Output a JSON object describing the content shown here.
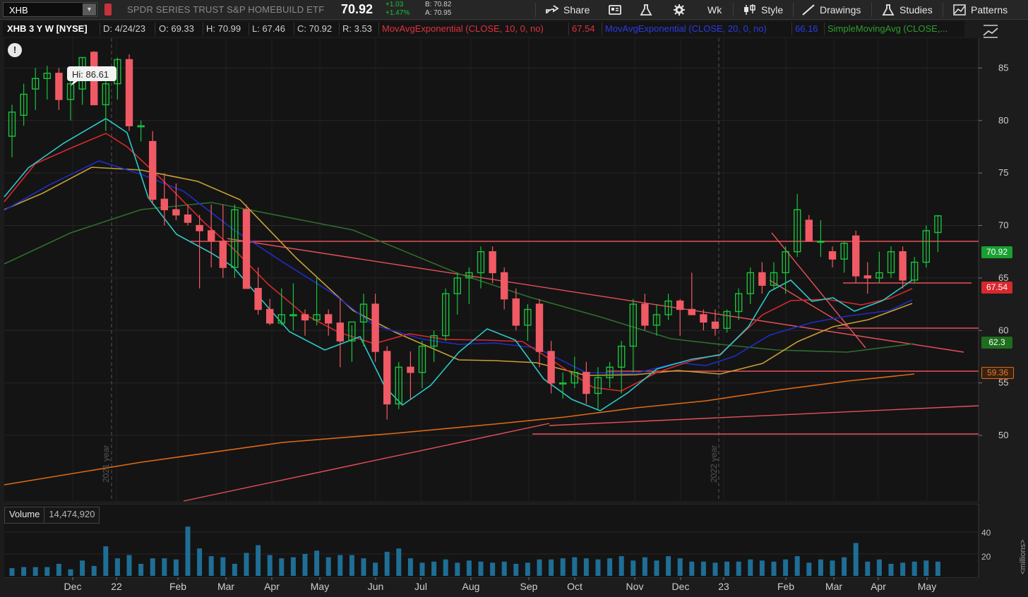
{
  "toolbar": {
    "symbol": "XHB",
    "security_name": "SPDR SERIES TRUST S&P HOMEBUILD ETF",
    "last": "70.92",
    "change": "+1.03",
    "change_pct": "+1.47%",
    "bid": "B: 70.82",
    "ask": "A: 70.95",
    "share": "Share",
    "aggregation": "Wk",
    "style": "Style",
    "drawings": "Drawings",
    "studies": "Studies",
    "patterns": "Patterns"
  },
  "legend": {
    "title": "XHB 3 Y W [NYSE]",
    "date": "D: 4/24/23",
    "open": "O: 69.33",
    "high": "H: 70.99",
    "low": "L: 67.46",
    "close": "C: 70.92",
    "range": "R: 3.53",
    "study1_name": "MovAvgExponential (CLOSE, 10, 0, no)",
    "study1_value": "67.54",
    "study2_name": "MovAvgExponential (CLOSE, 20, 0, no)",
    "study2_value": "66.16",
    "study3_name": "SimpleMovingAvg (CLOSE,..."
  },
  "hi_label": "Hi: 86.61",
  "year_markers": [
    "2021 year",
    "2022 year"
  ],
  "price_tags": {
    "last": "70.92",
    "ema10": "67.54",
    "sma_a": "62.3",
    "sma_b": "59.36"
  },
  "volume": {
    "title": "Volume",
    "value": "14,474,920",
    "unit": "<millions>",
    "ticks": [
      "40",
      "20"
    ]
  },
  "time_axis": [
    "Dec",
    "22",
    "Feb",
    "Mar",
    "Apr",
    "May",
    "Jun",
    "Jul",
    "Aug",
    "Sep",
    "Oct",
    "Nov",
    "Dec",
    "23",
    "Feb",
    "Mar",
    "Apr",
    "May"
  ],
  "colors": {
    "up": "#19c23c",
    "down": "#f05a64",
    "ema10": "#d8282d",
    "ema20": "#1e2dc8",
    "sma_green": "#2e6e2e",
    "sma_yellow": "#c8a032",
    "sma_orange": "#e06a14",
    "ema_cyan": "#2ec8c8",
    "trend": "#e8505a",
    "volume": "#1e6e96"
  },
  "chart_data": {
    "type": "candlestick",
    "symbol": "XHB",
    "interval": "weekly",
    "ylim": [
      48,
      91
    ],
    "y_ticks": [
      50,
      55,
      60,
      65,
      70,
      75,
      80,
      85,
      90
    ],
    "x_ticks": [
      "Dec",
      "22",
      "Feb",
      "Mar",
      "Apr",
      "May",
      "Jun",
      "Jul",
      "Aug",
      "Sep",
      "Oct",
      "Nov",
      "Dec",
      "23",
      "Feb",
      "Mar",
      "Apr",
      "May"
    ],
    "series": [
      {
        "name": "XHB",
        "ohlc": [
          [
            78.5,
            81.5,
            76.5,
            80.8
          ],
          [
            80.5,
            83.5,
            79.5,
            82.5
          ],
          [
            83.0,
            85.0,
            81.0,
            84.0
          ],
          [
            84.0,
            85.2,
            82.0,
            84.5
          ],
          [
            84.5,
            85.0,
            81.0,
            82.0
          ],
          [
            82.0,
            84.0,
            80.0,
            83.5
          ],
          [
            83.0,
            86.0,
            81.5,
            86.0
          ],
          [
            86.5,
            86.61,
            81.5,
            81.5
          ],
          [
            81.5,
            84.0,
            79.0,
            83.5
          ],
          [
            83.5,
            86.0,
            82.0,
            85.8
          ],
          [
            85.8,
            86.3,
            79.0,
            79.5
          ],
          [
            79.5,
            80.0,
            78.0,
            79.5
          ],
          [
            78.0,
            79.0,
            72.0,
            72.5
          ],
          [
            72.5,
            75.0,
            70.0,
            71.5
          ],
          [
            71.5,
            74.0,
            70.5,
            71.0
          ],
          [
            71.0,
            72.0,
            70.0,
            70.3
          ],
          [
            70.0,
            71.0,
            64.0,
            69.5
          ],
          [
            69.5,
            72.0,
            66.0,
            68.5
          ],
          [
            68.5,
            72.0,
            65.0,
            66.0
          ],
          [
            66.0,
            72.0,
            65.0,
            71.5
          ],
          [
            71.5,
            72.0,
            64.0,
            64.0
          ],
          [
            64.0,
            66.0,
            61.5,
            62.0
          ],
          [
            62.0,
            63.0,
            60.5,
            60.7
          ],
          [
            60.7,
            64.0,
            60.5,
            61.5
          ],
          [
            61.5,
            64.5,
            60.0,
            61.5
          ],
          [
            61.5,
            62.0,
            59.5,
            61.0
          ],
          [
            61.0,
            65.0,
            60.5,
            61.5
          ],
          [
            61.5,
            62.0,
            59.5,
            60.7
          ],
          [
            60.7,
            63.0,
            56.5,
            59.0
          ],
          [
            59.0,
            60.5,
            57.0,
            60.8
          ],
          [
            60.8,
            63.5,
            58.5,
            62.5
          ],
          [
            62.5,
            63.5,
            57.0,
            58.0
          ],
          [
            58.0,
            58.5,
            51.5,
            53.0
          ],
          [
            53.0,
            57.0,
            52.5,
            56.5
          ],
          [
            56.5,
            58.0,
            53.5,
            56.0
          ],
          [
            56.0,
            59.0,
            54.5,
            58.5
          ],
          [
            58.5,
            60.0,
            57.0,
            59.5
          ],
          [
            59.5,
            64.0,
            59.0,
            63.5
          ],
          [
            63.5,
            65.5,
            61.5,
            65.0
          ],
          [
            65.0,
            66.0,
            62.5,
            65.5
          ],
          [
            65.5,
            68.0,
            64.0,
            67.5
          ],
          [
            67.5,
            68.0,
            64.5,
            65.5
          ],
          [
            65.5,
            66.0,
            62.0,
            63.0
          ],
          [
            63.0,
            64.0,
            60.0,
            60.5
          ],
          [
            60.5,
            62.5,
            59.0,
            62.0
          ],
          [
            62.5,
            63.0,
            56.5,
            58.0
          ],
          [
            58.0,
            59.0,
            54.0,
            55.0
          ],
          [
            55.0,
            56.0,
            53.5,
            55.0
          ],
          [
            55.0,
            57.5,
            54.5,
            56.0
          ],
          [
            56.0,
            57.0,
            53.0,
            54.0
          ],
          [
            54.0,
            56.5,
            52.5,
            55.5
          ],
          [
            55.5,
            57.0,
            54.5,
            56.5
          ],
          [
            56.5,
            59.0,
            54.0,
            58.5
          ],
          [
            58.5,
            63.0,
            56.0,
            62.5
          ],
          [
            62.5,
            63.5,
            60.0,
            60.5
          ],
          [
            60.5,
            62.5,
            59.5,
            61.5
          ],
          [
            61.5,
            63.5,
            61.0,
            62.8
          ],
          [
            62.8,
            63.0,
            59.5,
            62.0
          ],
          [
            62.0,
            65.5,
            61.5,
            61.5
          ],
          [
            61.5,
            62.0,
            60.0,
            60.8
          ],
          [
            60.8,
            62.0,
            59.5,
            60.2
          ],
          [
            60.2,
            62.0,
            59.8,
            61.8
          ],
          [
            61.8,
            64.0,
            61.0,
            63.5
          ],
          [
            63.5,
            66.0,
            62.5,
            65.5
          ],
          [
            65.5,
            66.5,
            63.5,
            64.3
          ],
          [
            64.3,
            66.5,
            64.0,
            65.5
          ],
          [
            65.5,
            68.0,
            63.5,
            67.5
          ],
          [
            67.5,
            73.0,
            67.0,
            71.5
          ],
          [
            70.5,
            71.0,
            68.5,
            68.5
          ],
          [
            68.5,
            70.5,
            67.0,
            68.5
          ],
          [
            67.5,
            68.0,
            66.0,
            66.8
          ],
          [
            66.8,
            68.5,
            65.5,
            68.3
          ],
          [
            69.0,
            69.5,
            64.5,
            65.2
          ],
          [
            65.2,
            66.5,
            63.5,
            65.0
          ],
          [
            65.0,
            67.5,
            64.5,
            65.5
          ],
          [
            65.5,
            68.0,
            65.0,
            67.5
          ],
          [
            67.5,
            68.0,
            64.0,
            64.8
          ],
          [
            64.8,
            67.0,
            64.5,
            66.5
          ],
          [
            66.5,
            70.0,
            66.0,
            69.5
          ],
          [
            69.33,
            70.99,
            67.46,
            70.92
          ]
        ]
      },
      {
        "name": "MovAvgExponential (CLOSE, 10, 0, no)",
        "last": 67.54
      },
      {
        "name": "MovAvgExponential (CLOSE, 20, 0, no)",
        "last": 66.16
      },
      {
        "name": "SimpleMovingAvg (CLOSE,..."
      }
    ],
    "annotations": [
      "Hi: 86.61"
    ],
    "volume": {
      "ylim": [
        0,
        45
      ],
      "ticks": [
        20,
        40
      ],
      "unit": "millions",
      "last": 14474920
    }
  }
}
